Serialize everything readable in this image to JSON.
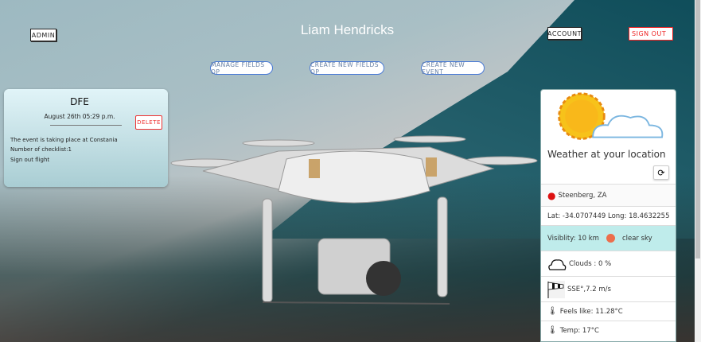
{
  "header": {
    "title": "Liam Hendricks",
    "admin": "ADMIN",
    "account": "ACCOUNT",
    "sign_out": "SIGN OUT"
  },
  "nav": {
    "manage": "MANAGE FIELDS OP",
    "create_fields": "CREATE NEW FIELDS OP",
    "create_event": "CREATE NEW EVENT"
  },
  "event": {
    "name": "DFE",
    "date": "August 26th 05:29 p.m.",
    "delete": "DELETE",
    "location": "The event is taking place at Constania",
    "checklist": "Number of checklist:1",
    "sign_out_flight": "Sign out flight"
  },
  "weather": {
    "title": "Weather at your location",
    "place": "Steenberg, ZA",
    "coords": "Lat: -34.0707449 Long: 18.4632255",
    "visibility": "Visiblity: 10 km",
    "sky": "clear sky",
    "clouds": "Clouds : 0 %",
    "wind": "SSE°,7.2 m/s",
    "feels": "Feels like: 11.28°C",
    "temp": "Temp: 17°C",
    "accent": "#bfeceb",
    "dot": "#ec6e4c"
  }
}
